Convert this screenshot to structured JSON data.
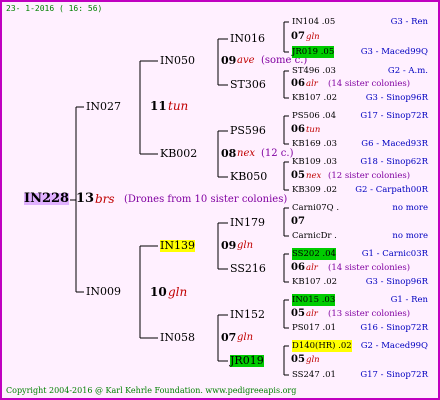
{
  "header": {
    "date": "23- 1-2016 ( 16: 56)"
  },
  "footer": {
    "copyright": "Copyright 2004-2016 @ Karl Kehrle Foundation.   www.pedigreeapis.org"
  },
  "colors": {
    "border": "#c000c0",
    "background": "#fff0ff",
    "highlight_green": "#00cc00",
    "highlight_yellow": "#ffff00",
    "highlight_root": "#e0b0ff"
  },
  "root": {
    "id": "IN228",
    "number": "13",
    "mark": "brs",
    "note": "(Drones from 10 sister colonies)"
  },
  "gen1": [
    {
      "id": "IN027",
      "number": "11",
      "mark": "tun"
    },
    {
      "id": "IN009",
      "number": "10",
      "mark": "gln"
    }
  ],
  "gen2": [
    {
      "id": "IN050",
      "number": "09",
      "mark": "ave",
      "note": "(some c.)"
    },
    {
      "id": "KB002",
      "number": "08",
      "mark": "nex",
      "note": "(12 c.)"
    },
    {
      "id": "IN139",
      "number": "09",
      "mark": "gln"
    },
    {
      "id": "IN058",
      "number": "07",
      "mark": "gln"
    }
  ],
  "gen3": [
    {
      "id": "IN016",
      "number": "07",
      "mark": "gln"
    },
    {
      "id": "ST306",
      "number": "06",
      "mark": "alr",
      "note": "(14 sister colonies)"
    },
    {
      "id": "PS596",
      "number": "06",
      "mark": "tun"
    },
    {
      "id": "KB050",
      "number": "05",
      "mark": "nex",
      "note": "(12 sister colonies)"
    },
    {
      "id": "IN179",
      "number": "07",
      "mark": ""
    },
    {
      "id": "SS216",
      "number": "06",
      "mark": "alr",
      "note": "(14 sister colonies)"
    },
    {
      "id": "IN152",
      "number": "05",
      "mark": "alr",
      "note": "(13 sister colonies)"
    },
    {
      "id": "JR019",
      "number": "05",
      "mark": "gln"
    }
  ],
  "gen4": [
    {
      "id": "IN104 .05",
      "line": "G3 - Ren"
    },
    {
      "id": "JR019 .05",
      "line": "G3 - Maced99Q"
    },
    {
      "id": "ST496 .03",
      "line": "G2 - A.m."
    },
    {
      "id": "KB107 .02",
      "line": "G3 - Sinop96R"
    },
    {
      "id": "PS506 .04",
      "line": "G17 - Sinop72R"
    },
    {
      "id": "KB169 .03",
      "line": "G6 - Maced93R"
    },
    {
      "id": "KB109 .03",
      "line": "G18 - Sinop62R"
    },
    {
      "id": "KB309 .02",
      "line": "G2 - Carpath00R"
    },
    {
      "id": "Carni07Q .",
      "line": "no more"
    },
    {
      "id": "CarnicDr .",
      "line": "no more"
    },
    {
      "id": "SS202 .04",
      "line": "G1 - Carnic03R"
    },
    {
      "id": "KB107 .02",
      "line": "G3 - Sinop96R"
    },
    {
      "id": "IN015 .03",
      "line": "G1 - Ren"
    },
    {
      "id": "PS017 .01",
      "line": "G16 - Sinop72R"
    },
    {
      "id": "D140(HR) .02",
      "line": "G2 - Maced99Q"
    },
    {
      "id": "SS247 .01",
      "line": "G17 - Sinop72R"
    }
  ]
}
